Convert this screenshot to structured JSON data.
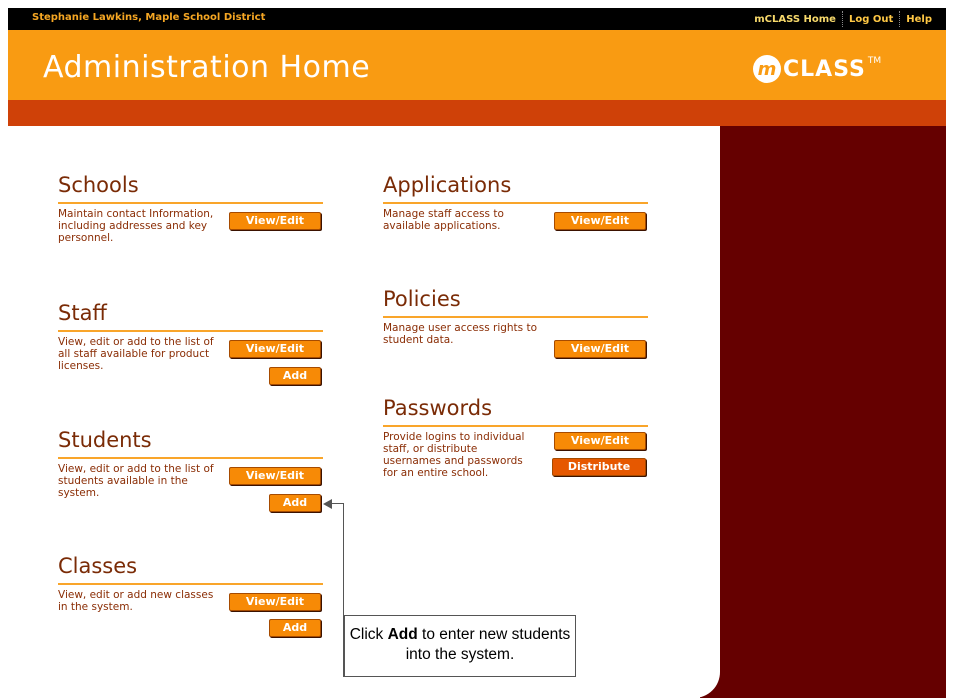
{
  "user_label": "Stephanie Lawkins, Maple School District",
  "nav": {
    "home": "mCLASS Home",
    "logout": "Log Out",
    "help": "Help"
  },
  "page_title": "Administration Home",
  "logo": {
    "mark": "m",
    "text": "CLASS",
    "tm": "TM"
  },
  "sections": {
    "schools": {
      "title": "Schools",
      "desc": "Maintain contact Information, including addresses and key personnel.",
      "view": "View/Edit"
    },
    "staff": {
      "title": "Staff",
      "desc": "View, edit or add to the list of all staff available for product licenses.",
      "view": "View/Edit",
      "add": "Add"
    },
    "students": {
      "title": "Students",
      "desc": "View, edit or add to the list of students available in the system.",
      "view": "View/Edit",
      "add": "Add"
    },
    "classes": {
      "title": "Classes",
      "desc": "View, edit or add new classes in the system.",
      "view": "View/Edit",
      "add": "Add"
    },
    "applications": {
      "title": "Applications",
      "desc": "Manage staff access to available applications.",
      "view": "View/Edit"
    },
    "policies": {
      "title": "Policies",
      "desc": "Manage user access rights to student data.",
      "view": "View/Edit"
    },
    "passwords": {
      "title": "Passwords",
      "desc": "Provide logins to individual staff, or distribute usernames and passwords for an entire school.",
      "view": "View/Edit",
      "distribute": "Distribute"
    }
  },
  "callout": {
    "pre": "Click ",
    "bold": "Add",
    "post": " to enter new students into the system."
  },
  "colors": {
    "header": "#f99b12",
    "band": "#cf4108",
    "side": "#650000",
    "button": "#f78a06"
  }
}
